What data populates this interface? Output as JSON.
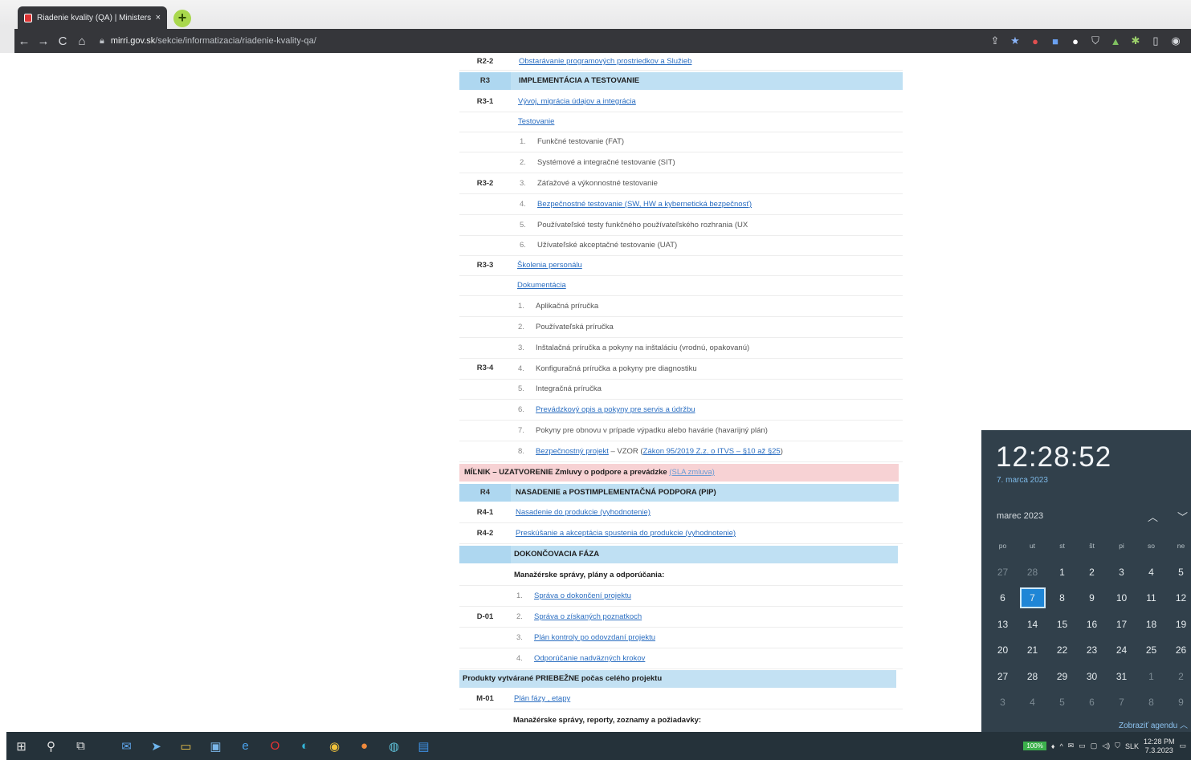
{
  "browser": {
    "tab_title": "Riadenie kvality (QA) | Ministerst",
    "tab_close": "×",
    "new_tab": "+",
    "url_host": "mirri.gov.sk",
    "url_path": "/sekcie/informatizacia/riadenie-kvality-qa/",
    "nav": {
      "back": "←",
      "forward": "→",
      "reload": "C",
      "home": "⌂"
    }
  },
  "table": {
    "rows": {
      "r2_2": {
        "code": "R2-2",
        "text": "Obstarávanie programových prostriedkov a Služieb"
      },
      "r3": {
        "code": "R3",
        "text": "IMPLEMENTÁCIA A TESTOVANIE"
      },
      "r3_1": {
        "code": "R3-1",
        "text": "Vývoj, migrácia údajov a integrácia"
      },
      "r3_2": {
        "code": "R3-2",
        "heading": "Testovanie",
        "items": [
          {
            "num": "1.",
            "text": "Funkčné testovanie (FAT)"
          },
          {
            "num": "2.",
            "text": "Systémové a integračné testovanie (SIT)"
          },
          {
            "num": "3.",
            "text": "Záťažové a výkonnostné testovanie"
          },
          {
            "num": "4.",
            "text": "Bezpečnostné testovanie (SW, HW a kybernetická bezpečnosť)"
          },
          {
            "num": "5.",
            "text": "Používateľské testy funkčného používateľského rozhrania (UX"
          },
          {
            "num": "6.",
            "text": "Užívateľské akceptačné testovanie (UAT)"
          }
        ]
      },
      "r3_3": {
        "code": "R3-3",
        "text": "Školenia personálu"
      },
      "r3_4": {
        "code": "R3-4",
        "heading": "Dokumentácia",
        "items": [
          {
            "num": "1.",
            "text": "Aplikačná príručka"
          },
          {
            "num": "2.",
            "text": "Používateľská príručka"
          },
          {
            "num": "3.",
            "text": "Inštalačná príručka a pokyny na inštaláciu (vrodnú, opakovanú)"
          },
          {
            "num": "4.",
            "text": "Konfiguračná príručka a pokyny pre diagnostiku"
          },
          {
            "num": "5.",
            "text": "Integračná príručka"
          },
          {
            "num": "6.",
            "text": "Prevádzkový opis a pokyny pre servis a údržbu"
          },
          {
            "num": "7.",
            "text": "Pokyny pre obnovu v prípade výpadku alebo havárie (havarijný plán)"
          },
          {
            "num": "8.",
            "text": "Bezpečnostný projekt",
            "suffix": " – VZOR (",
            "law": "Zákon 95/2019 Z.z. o ITVS – §10 až §25",
            "close": ")"
          }
        ]
      },
      "milestone": {
        "text": "MÍĽNIK – UZATVORENIE Zmluvy o podpore a prevádzke",
        "sla": "(SLA zmluva)"
      },
      "r4": {
        "code": "R4",
        "text": "NASADENIE a POSTIMPLEMENTAČNÁ PODPORA (PIP)"
      },
      "r4_1": {
        "code": "R4-1",
        "text": "Nasadenie do produkcie (vyhodnotenie)"
      },
      "r4_2": {
        "code": "R4-2",
        "text": "Preskúšanie a akceptácia spustenia do produkcie (vyhodnotenie)"
      },
      "final": {
        "text": "DOKONČOVACIA FÁZA"
      },
      "d01": {
        "code": "D-01",
        "heading": "Manažérske správy, plány a odporúčania:",
        "items": [
          {
            "num": "1.",
            "text": "Správa o dokončení projektu"
          },
          {
            "num": "2.",
            "text": "Správa o získaných poznatkoch"
          },
          {
            "num": "3.",
            "text": "Plán kontroly po odovzdaní projektu"
          },
          {
            "num": "4.",
            "text": "Odporúčanie nadväzných krokov"
          }
        ]
      },
      "ongoing": {
        "text": "Produkty vytvárané PRIEBEŽNE počas celého projektu"
      },
      "m01": {
        "code": "M-01",
        "text": "Plán fázy , etapy"
      },
      "last": {
        "text": "Manažérske správy, reporty, zoznamy a požiadavky:"
      }
    }
  },
  "clock": {
    "time": "12:28:52",
    "date": "7. marca 2023",
    "month": "marec 2023",
    "up": "︿",
    "down": "﹀",
    "weekdays": [
      "po",
      "ut",
      "st",
      "št",
      "pi",
      "so",
      "ne"
    ],
    "weeks": [
      [
        "27",
        "28",
        "1",
        "2",
        "3",
        "4",
        "5"
      ],
      [
        "6",
        "7",
        "8",
        "9",
        "10",
        "11",
        "12"
      ],
      [
        "13",
        "14",
        "15",
        "16",
        "17",
        "18",
        "19"
      ],
      [
        "20",
        "21",
        "22",
        "23",
        "24",
        "25",
        "26"
      ],
      [
        "27",
        "28",
        "29",
        "30",
        "31",
        "1",
        "2"
      ],
      [
        "3",
        "4",
        "5",
        "6",
        "7",
        "8",
        "9"
      ]
    ],
    "today": "7",
    "agenda": "Zobraziť agendu ︿"
  },
  "taskbar": {
    "battery": "100%",
    "lang": "SLK",
    "time": "12:28 PM",
    "date": "7.3.2023"
  }
}
